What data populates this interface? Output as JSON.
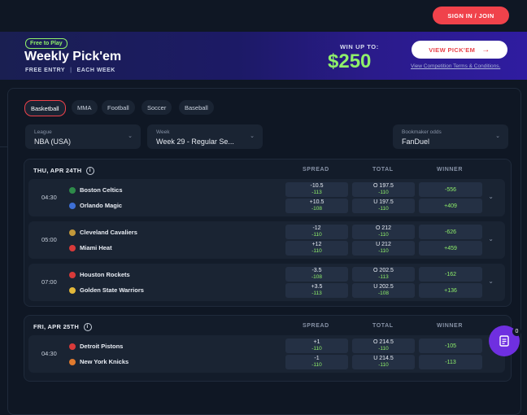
{
  "header": {
    "signin_label": "SIGN IN / JOIN"
  },
  "banner": {
    "badge": "Free to Play",
    "title": "Weekly Pick'em",
    "sub_left": "FREE ENTRY",
    "sub_sep": "|",
    "sub_right": "EACH WEEK",
    "win_up_to": "WIN UP TO:",
    "amount": "$250",
    "cta_label": "VIEW PICK'EM",
    "cta_arrow": "→",
    "terms": "View Competition Terms & Conditions.",
    "colors": {
      "accent_green": "#8ff06a",
      "cta_red": "#e8424a"
    }
  },
  "sports_tabs": [
    {
      "label": "Basketball",
      "active": true
    },
    {
      "label": "MMA",
      "active": false
    },
    {
      "label": "Football",
      "active": false
    },
    {
      "label": "Soccer",
      "active": false
    },
    {
      "label": "Baseball",
      "active": false
    }
  ],
  "filters": {
    "league": {
      "label": "League",
      "value": "NBA (USA)"
    },
    "week": {
      "label": "Week",
      "value": "Week 29 - Regular Se..."
    },
    "bookmaker": {
      "label": "Bookmaker odds",
      "value": "FanDuel"
    }
  },
  "columns": {
    "spread": "SPREAD",
    "total": "TOTAL",
    "winner": "WINNER"
  },
  "days": [
    {
      "date": "THU, APR 24TH",
      "games": [
        {
          "time": "04:30",
          "home": {
            "name": "Boston Celtics",
            "logo_color": "#2e8b4a",
            "spread": "-10.5",
            "spread_odds": "-113",
            "total": "O 197.5",
            "total_odds": "-110",
            "winner": "-556"
          },
          "away": {
            "name": "Orlando Magic",
            "logo_color": "#3d6fd6",
            "spread": "+10.5",
            "spread_odds": "-108",
            "total": "U 197.5",
            "total_odds": "-110",
            "winner": "+409"
          }
        },
        {
          "time": "05:00",
          "home": {
            "name": "Cleveland Cavaliers",
            "logo_color": "#c2983a",
            "spread": "-12",
            "spread_odds": "-110",
            "total": "O 212",
            "total_odds": "-110",
            "winner": "-626"
          },
          "away": {
            "name": "Miami Heat",
            "logo_color": "#d83a3a",
            "spread": "+12",
            "spread_odds": "-110",
            "total": "U 212",
            "total_odds": "-110",
            "winner": "+459"
          }
        },
        {
          "time": "07:00",
          "home": {
            "name": "Houston Rockets",
            "logo_color": "#d83a3a",
            "spread": "-3.5",
            "spread_odds": "-108",
            "total": "O 202.5",
            "total_odds": "-113",
            "winner": "-162"
          },
          "away": {
            "name": "Golden State Warriors",
            "logo_color": "#e3b83a",
            "spread": "+3.5",
            "spread_odds": "-113",
            "total": "U 202.5",
            "total_odds": "-108",
            "winner": "+136"
          }
        }
      ]
    },
    {
      "date": "FRI, APR 25TH",
      "games": [
        {
          "time": "04:30",
          "home": {
            "name": "Detroit Pistons",
            "logo_color": "#d83a3a",
            "spread": "+1",
            "spread_odds": "-110",
            "total": "O 214.5",
            "total_odds": "-110",
            "winner": "-105"
          },
          "away": {
            "name": "New York Knicks",
            "logo_color": "#e07a2e",
            "spread": "-1",
            "spread_odds": "-110",
            "total": "U 214.5",
            "total_odds": "-110",
            "winner": "-113"
          }
        }
      ]
    }
  ],
  "fab": {
    "badge": "0"
  }
}
